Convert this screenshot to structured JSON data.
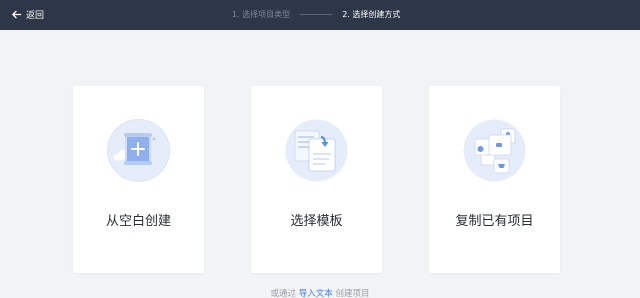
{
  "header": {
    "back_label": "返回",
    "steps": [
      {
        "label": "1. 选择项目类型",
        "active": false
      },
      {
        "label": "2. 选择创建方式",
        "active": true
      }
    ]
  },
  "cards": [
    {
      "label": "从空白创建",
      "icon": "blank-create-icon"
    },
    {
      "label": "选择模板",
      "icon": "template-icon"
    },
    {
      "label": "复制已有项目",
      "icon": "copy-project-icon"
    }
  ],
  "footer": {
    "prefix": "或通过",
    "link": "导入文本",
    "suffix": "创建项目"
  },
  "colors": {
    "header_bg": "#2e3748",
    "page_bg": "#f2f3f5",
    "accent": "#4a7ee0"
  }
}
